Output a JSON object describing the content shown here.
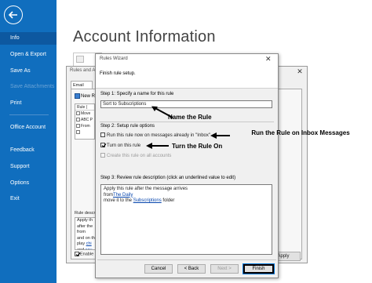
{
  "sidebar": {
    "items": [
      {
        "label": "Info"
      },
      {
        "label": "Open & Export"
      },
      {
        "label": "Save As"
      },
      {
        "label": "Save Attachments"
      },
      {
        "label": "Print"
      },
      {
        "label": "Office Account"
      },
      {
        "label": "Feedback"
      },
      {
        "label": "Support"
      },
      {
        "label": "Options"
      },
      {
        "label": "Exit"
      }
    ],
    "bg_color": "#106ebe",
    "active_color": "#0d58a0"
  },
  "main": {
    "title": "Account Information"
  },
  "rules_alerts": {
    "title": "Rules and A",
    "tab": "Email Rule",
    "new_rule": "New R",
    "list_header": "Rule (",
    "rows": [
      "Move",
      "ABC P",
      "From",
      ""
    ],
    "desc_label": "Rule descr",
    "desc_lines": [
      "Apply th",
      "after the",
      "from",
      "and on th",
      "play",
      "and"
    ],
    "desc_links": [
      "chi",
      "sou"
    ],
    "enable_label": "Enable",
    "apply_button": "Apply"
  },
  "wizard": {
    "title": "Rules Wizard",
    "subtitle": "Finish rule setup.",
    "step1_label": "Step 1: Specify a name for this rule",
    "rule_name": "Sort to Subscriptions",
    "step2_label": "Step 2: Setup rule options",
    "option_run_now": "Run this rule now on messages already in \"Inbox\"",
    "option_turn_on": "Turn on this rule",
    "option_all_accounts": "Create this rule on all accounts",
    "step3_label": "Step 3: Review rule description (click an underlined value to edit)",
    "desc_line1": "Apply this rule after the message arrives",
    "desc_from": "from",
    "desc_from_link": "The Daily",
    "desc_move_pre": "move it to the",
    "desc_move_link": "Subscriptions",
    "desc_move_post": "folder",
    "buttons": {
      "cancel": "Cancel",
      "back": "< Back",
      "next": "Next >",
      "finish": "Finish"
    }
  },
  "annotations": {
    "name_rule": "Name the Rule",
    "run_rule": "Run the Rule on Inbox Messages",
    "turn_on": "Turn the Rule On"
  },
  "colors": {
    "link": "#0645ad",
    "dialog_bg": "#f0f0f0"
  }
}
